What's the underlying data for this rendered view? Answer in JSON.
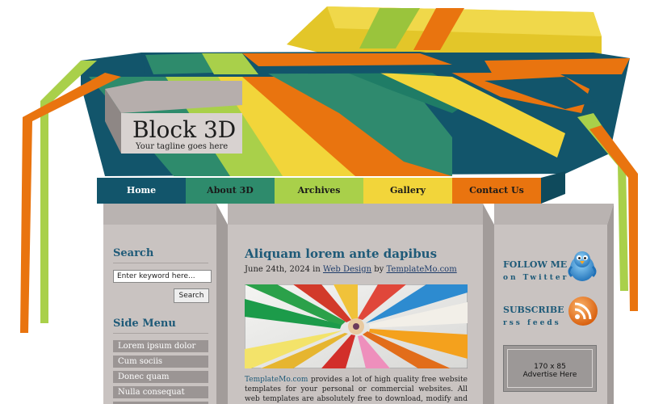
{
  "site": {
    "title": "Block 3D",
    "tagline": "Your tagline goes here"
  },
  "nav": [
    {
      "label": "Home",
      "bg": "#12556b",
      "fg": "#ffffff"
    },
    {
      "label": "About 3D",
      "bg": "#2e8b6c",
      "fg": "#1a1a1a"
    },
    {
      "label": "Archives",
      "bg": "#a9d04a",
      "fg": "#1a1a1a"
    },
    {
      "label": "Gallery",
      "bg": "#f2d53a",
      "fg": "#1a1a1a"
    },
    {
      "label": "Contact Us",
      "bg": "#e9740f",
      "fg": "#1a1a1a"
    }
  ],
  "sidebar_left": {
    "search_heading": "Search",
    "search_placeholder": "Enter keyword here...",
    "search_button": "Search",
    "menu_heading": "Side Menu",
    "menu_items": [
      "Lorem ipsum dolor",
      "Cum sociis",
      "Donec quam",
      "Nulla consequat",
      ""
    ]
  },
  "post": {
    "title": "Aliquam lorem ante dapibus",
    "date": "June 24th, 2024",
    "in_word": "in",
    "category": "Web Design",
    "by_word": "by",
    "author": "TemplateMo.com",
    "body_link": "TemplateMo.com",
    "body_text": " provides a lot of high quality free website templates for your personal or commercial websites. All web templates are absolutely free to download, modify and apply for any purpose"
  },
  "sidebar_right": {
    "follow_title": "FOLLOW ME",
    "follow_sub": "on Twitter",
    "subscribe_title": "SUBSCRIBE",
    "subscribe_sub": "rss feeds",
    "ad_size": "170 x 85",
    "ad_text": "Advertise Here"
  },
  "icons": {
    "twitter": "twitter-bird-icon",
    "rss": "rss-feed-icon",
    "pencils": "colored-pencils-image"
  },
  "colors": {
    "teal_dark": "#12556b",
    "green": "#2e8b6c",
    "lime": "#a9d04a",
    "yellow": "#f2d53a",
    "orange": "#e9740f",
    "heading_blue": "#1e5a78",
    "panel_grey": "#c9c3c1"
  }
}
